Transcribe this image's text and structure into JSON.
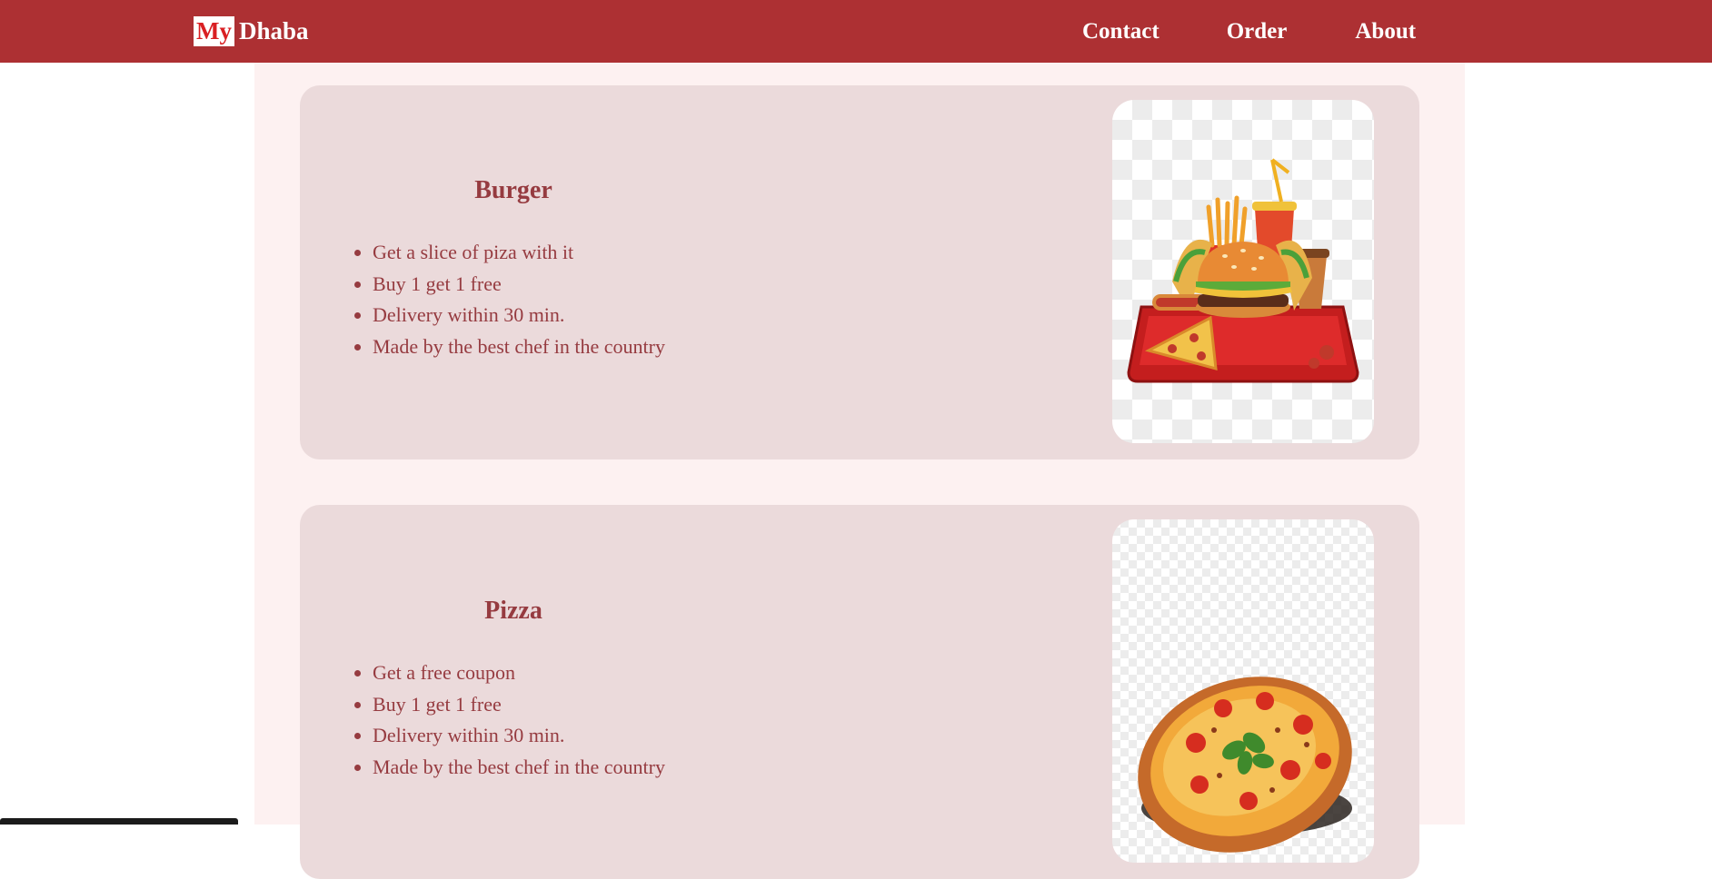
{
  "brand": {
    "logo_highlight": "My",
    "logo_rest": "Dhaba"
  },
  "nav": {
    "contact": "Contact",
    "order": "Order",
    "about": "About"
  },
  "products": [
    {
      "name": "Burger",
      "image_icon": "fast-food-tray-image",
      "features": [
        "Get a slice of piza with it",
        "Buy 1 get 1 free",
        "Delivery within 30 min.",
        "Made by the best chef in the country"
      ]
    },
    {
      "name": "Pizza",
      "image_icon": "pizza-image",
      "features": [
        "Get a free coupon",
        "Buy 1 get 1 free",
        "Delivery within 30 min.",
        "Made by the best chef in the country"
      ]
    }
  ],
  "colors": {
    "navbar": "#ad3033",
    "logo_highlight_text": "#d91f23",
    "page_background": "#fdf1f1",
    "card_background": "#ebdadb",
    "text_accent": "#963b40"
  }
}
